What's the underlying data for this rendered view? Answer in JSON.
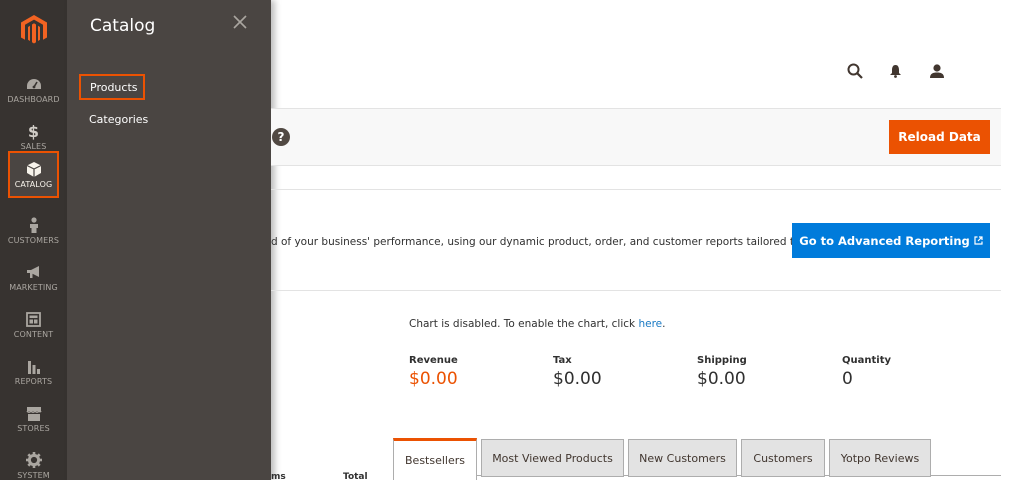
{
  "nav": {
    "items": [
      {
        "label": "DASHBOARD",
        "icon": "dashboard-icon"
      },
      {
        "label": "SALES",
        "icon": "dollar-icon"
      },
      {
        "label": "CATALOG",
        "icon": "box-icon"
      },
      {
        "label": "CUSTOMERS",
        "icon": "person-icon"
      },
      {
        "label": "MARKETING",
        "icon": "megaphone-icon"
      },
      {
        "label": "CONTENT",
        "icon": "layout-icon"
      },
      {
        "label": "REPORTS",
        "icon": "bar-chart-icon"
      },
      {
        "label": "STORES",
        "icon": "storefront-icon"
      },
      {
        "label": "SYSTEM",
        "icon": "gear-icon"
      }
    ],
    "active": "CATALOG"
  },
  "flyout": {
    "title": "Catalog",
    "products": "Products",
    "categories": "Categories"
  },
  "toolbar": {
    "help": "?",
    "reload_label": "Reload Data"
  },
  "intro": {
    "text": "d of your business' performance, using our dynamic product, order, and customer reports tailored to",
    "advanced_label": "Go to Advanced Reporting",
    "advanced_icon": "external-link-icon"
  },
  "chart": {
    "message": "Chart is disabled. To enable the chart, click ",
    "link": "here",
    "suffix": "."
  },
  "stats": {
    "revenue_label": "Revenue",
    "revenue_value": "$0.00",
    "tax_label": "Tax",
    "tax_value": "$0.00",
    "shipping_label": "Shipping",
    "shipping_value": "$0.00",
    "quantity_label": "Quantity",
    "quantity_value": "0"
  },
  "tabs": [
    "Bestsellers",
    "Most Viewed Products",
    "New Customers",
    "Customers",
    "Yotpo Reviews"
  ],
  "table": {
    "col_items": "ms",
    "col_total": "Total"
  },
  "colors": {
    "accent": "#eb5202",
    "nav_bg": "#373330",
    "flyout_bg": "#4a4542",
    "link_blue": "#007bdb"
  }
}
